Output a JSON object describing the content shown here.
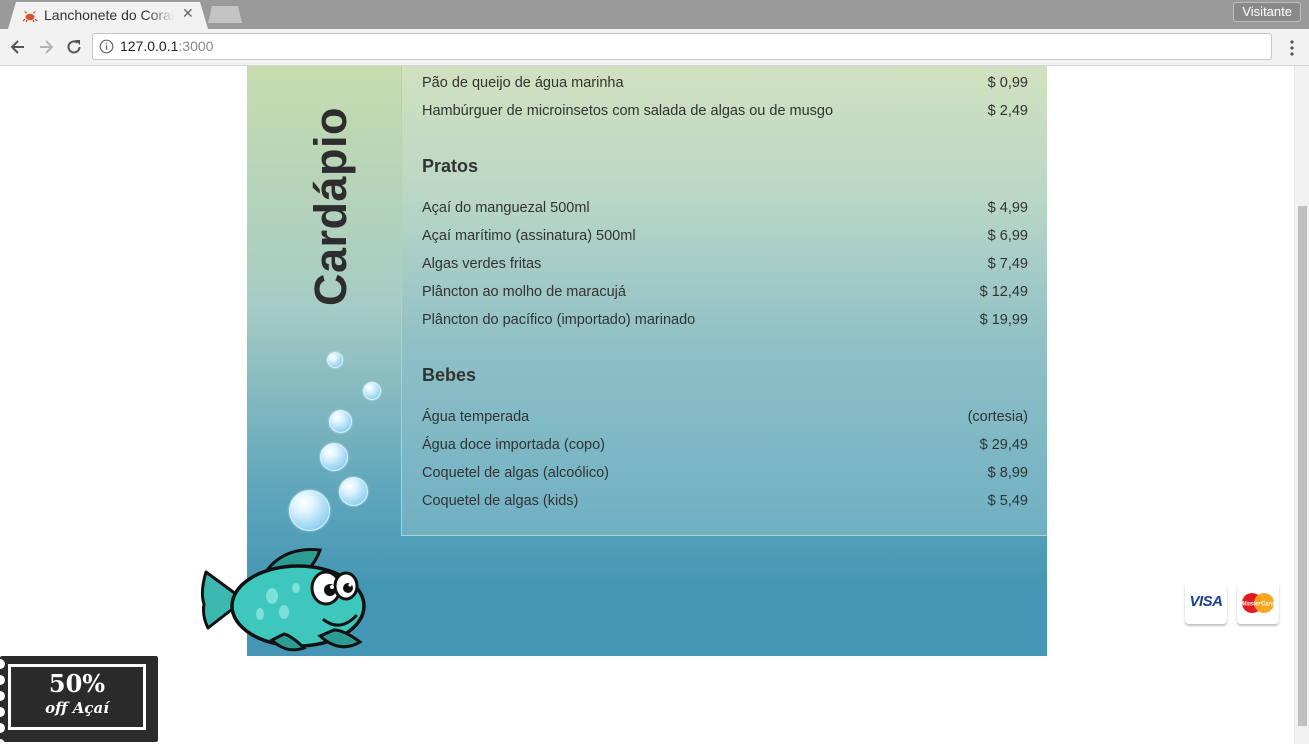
{
  "browser": {
    "tab_title": "Lanchonete do Coral",
    "profile_label": "Visitante",
    "url_host": "127.0.0.1",
    "url_port": ":3000"
  },
  "sidebar": {
    "title": "Cardápio"
  },
  "menu": {
    "top_items": [
      {
        "name": "Pão de queijo de água marinha",
        "price": "$ 0,99"
      },
      {
        "name": "Hambúrguer de microinsetos com salada de algas ou de musgo",
        "price": "$ 2,49"
      }
    ],
    "sections": [
      {
        "title": "Pratos",
        "items": [
          {
            "name": "Açaí do manguezal 500ml",
            "price": "$ 4,99"
          },
          {
            "name": "Açaí marítimo (assinatura) 500ml",
            "price": "$ 6,99"
          },
          {
            "name": "Algas verdes fritas",
            "price": "$ 7,49"
          },
          {
            "name": "Plâncton ao molho de maracujá",
            "price": "$ 12,49"
          },
          {
            "name": "Plâncton do pacífico (importado) marinado",
            "price": "$ 19,99"
          }
        ]
      },
      {
        "title": "Bebes",
        "items": [
          {
            "name": "Água temperada",
            "price": "(cortesia)"
          },
          {
            "name": "Água doce importada (copo)",
            "price": "$ 29,49"
          },
          {
            "name": "Coquetel de algas (alcoólico)",
            "price": "$ 8,99"
          },
          {
            "name": "Coquetel de algas (kids)",
            "price": "$ 5,49"
          }
        ]
      }
    ]
  },
  "payment": {
    "visa_label": "VISA",
    "mastercard_label": "MasterCard"
  },
  "coupon": {
    "percent": "50%",
    "text": "off Açaí"
  },
  "colors": {
    "panel_bottom": "#4497b4",
    "panel_top": "#c5dcae",
    "text": "#333333"
  },
  "icons": [
    "crab-favicon-icon",
    "back-arrow-icon",
    "forward-arrow-icon",
    "reload-icon",
    "info-icon",
    "kebab-menu-icon",
    "bubble-icon",
    "fish-icon",
    "visa-card-icon",
    "mastercard-icon"
  ]
}
